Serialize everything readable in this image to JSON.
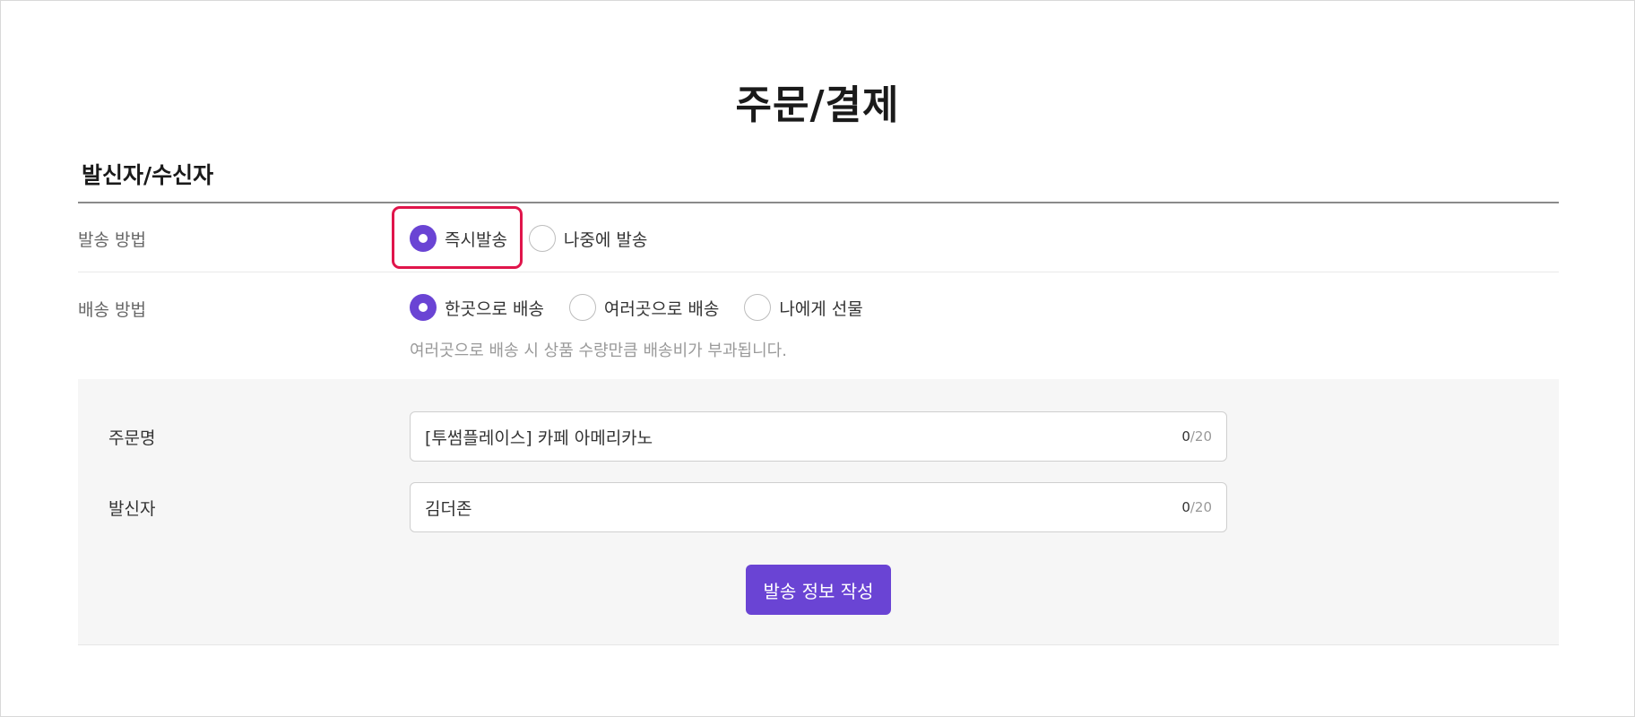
{
  "page": {
    "title": "주문/결제"
  },
  "section": {
    "title": "발신자/수신자"
  },
  "send_method": {
    "label": "발송 방법",
    "options": [
      {
        "label": "즉시발송",
        "checked": true
      },
      {
        "label": "나중에 발송",
        "checked": false
      }
    ]
  },
  "delivery_method": {
    "label": "배송 방법",
    "options": [
      {
        "label": "한곳으로 배송",
        "checked": true
      },
      {
        "label": "여러곳으로 배송",
        "checked": false
      },
      {
        "label": "나에게 선물",
        "checked": false
      }
    ],
    "hint": "여러곳으로 배송 시 상품 수량만큼 배송비가 부과됩니다."
  },
  "form": {
    "order_name": {
      "label": "주문명",
      "value": "[투썸플레이스] 카페 아메리카노",
      "count": "0",
      "max": "/20"
    },
    "sender": {
      "label": "발신자",
      "value": "김더존",
      "count": "0",
      "max": "/20"
    },
    "submit_label": "발송 정보 작성"
  },
  "colors": {
    "accent": "#6a44d4",
    "highlight": "#e0154b"
  }
}
